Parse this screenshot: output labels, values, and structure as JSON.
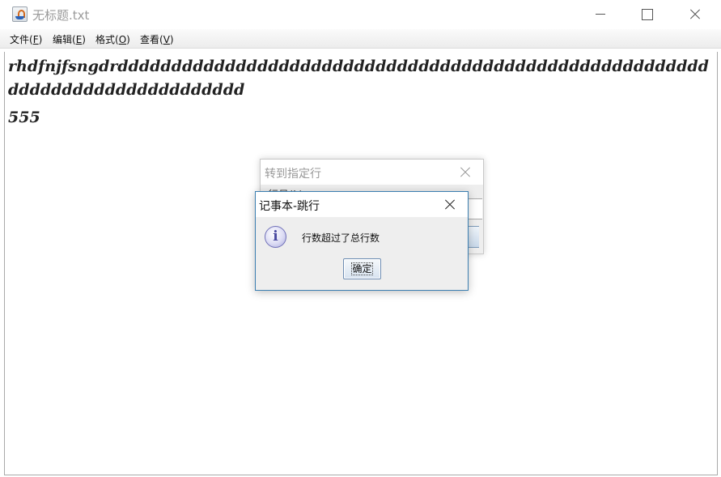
{
  "window": {
    "title": "无标题.txt",
    "minimize_icon": "minimize-icon",
    "maximize_icon": "maximize-icon",
    "close_icon": "close-icon"
  },
  "menu": {
    "items": [
      {
        "label": "文件(",
        "key": "F",
        "suffix": ")"
      },
      {
        "label": "编辑(",
        "key": "E",
        "suffix": ")"
      },
      {
        "label": "格式(",
        "key": "O",
        "suffix": ")"
      },
      {
        "label": "查看(",
        "key": "V",
        "suffix": ")"
      }
    ]
  },
  "editor": {
    "line1": "rhdfnjfsngdrddddddddddddddddddddddddddddddddddddddddddddddddddddddddddddddddddddddddddddd",
    "line3": "555"
  },
  "goto_dialog": {
    "title": "转到指定行",
    "label": "行号(L):"
  },
  "message_dialog": {
    "title": "记事本-跳行",
    "message": "行数超过了总行数",
    "ok_label": "确定",
    "icon": "information-icon"
  }
}
